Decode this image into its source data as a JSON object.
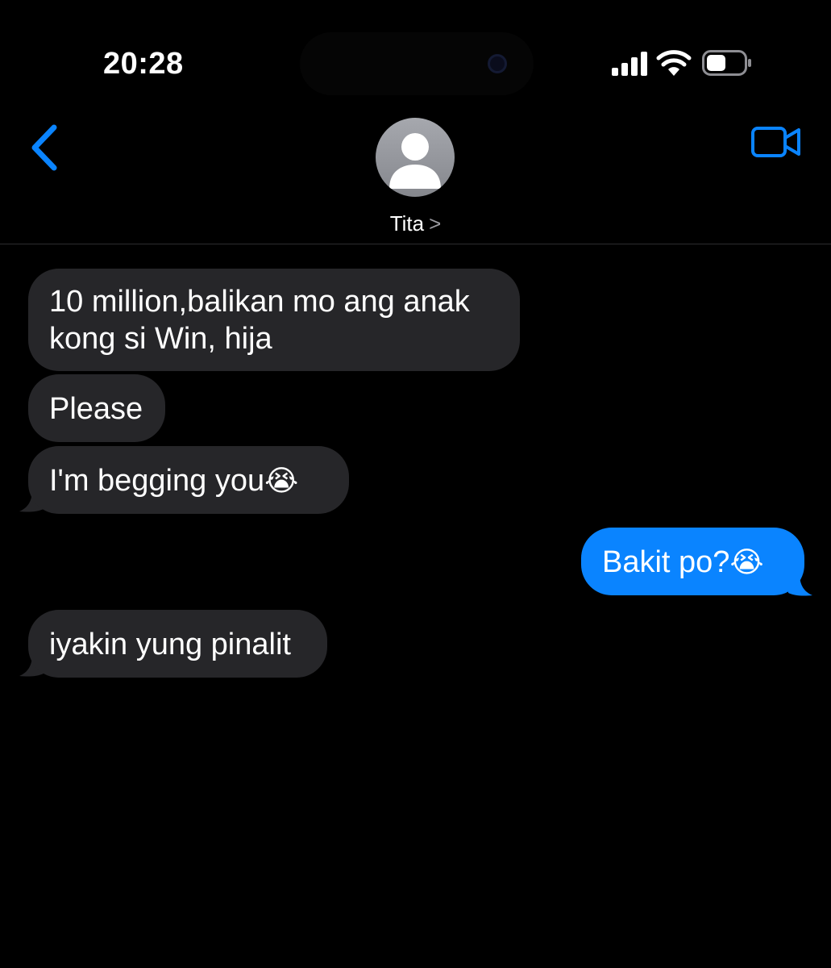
{
  "status_bar": {
    "time": "20:28"
  },
  "header": {
    "back_icon": "chevron-left-icon",
    "avatar_icon": "person-icon",
    "contact_name": "Tita",
    "contact_chevron": ">",
    "video_icon": "video-camera-icon"
  },
  "messages": [
    {
      "direction": "incoming",
      "line1": "10 million,balikan mo ang anak",
      "line2": "kong si Win, hija"
    },
    {
      "direction": "incoming",
      "text": "Please"
    },
    {
      "direction": "incoming",
      "text": "I'm begging you",
      "emoji": "😭"
    },
    {
      "direction": "outgoing",
      "text": "Bakit po?",
      "emoji": "😭"
    },
    {
      "direction": "incoming",
      "text": "iyakin yung pinalit"
    }
  ],
  "colors": {
    "background": "#000000",
    "incoming_bubble": "#262629",
    "outgoing_bubble": "#0a84ff",
    "accent": "#0a84ff"
  }
}
